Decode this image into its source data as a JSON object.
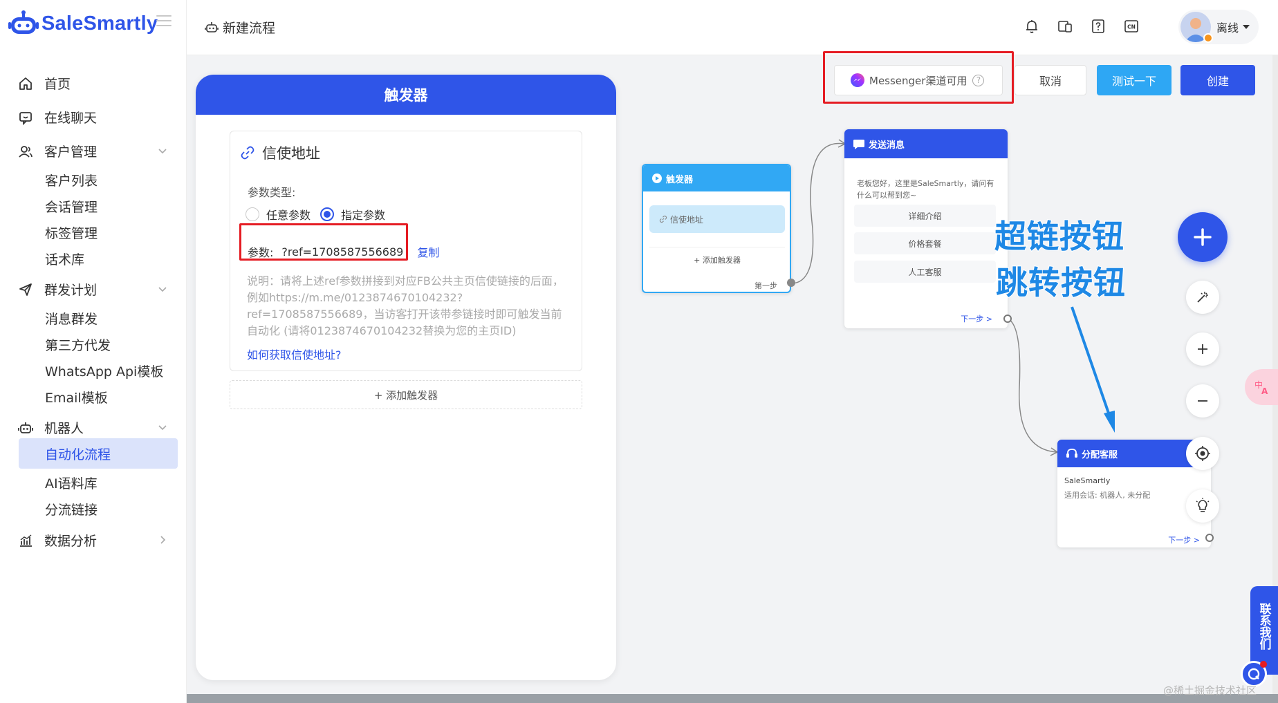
{
  "app": {
    "brand": "SaleSmartly"
  },
  "header": {
    "page_title": "新建流程",
    "user_status": "离线"
  },
  "sidebar": {
    "items": [
      {
        "label": "首页"
      },
      {
        "label": "在线聊天"
      },
      {
        "label": "客户管理"
      },
      {
        "label": "客户列表"
      },
      {
        "label": "会话管理"
      },
      {
        "label": "标签管理"
      },
      {
        "label": "话术库"
      },
      {
        "label": "群发计划"
      },
      {
        "label": "消息群发"
      },
      {
        "label": "第三方代发"
      },
      {
        "label": "WhatsApp Api模板"
      },
      {
        "label": "Email模板"
      },
      {
        "label": "机器人"
      },
      {
        "label": "自动化流程"
      },
      {
        "label": "AI语料库"
      },
      {
        "label": "分流链接"
      },
      {
        "label": "数据分析"
      }
    ],
    "active_item": "自动化流程"
  },
  "toolbar": {
    "channel_label": "Messenger渠道可用",
    "cancel_label": "取消",
    "test_label": "测试一下",
    "create_label": "创建"
  },
  "trigger_panel": {
    "title": "触发器",
    "card_title": "信使地址",
    "param_type_label": "参数类型:",
    "options": [
      "任意参数",
      "指定参数"
    ],
    "selected_option": "指定参数",
    "param_label": "参数:",
    "param_value": "?ref=1708587556689",
    "copy_label": "复制",
    "description": "说明：请将上述ref参数拼接到对应FB公共主页信使链接的后面，例如https://m.me/0123874670104232?ref=1708587556689，当访客打开该带参链接时即可触发当前自动化 (请将0123874670104232替换为您的主页ID)",
    "help_link": "如何获取信使地址?",
    "add_trigger": "+ 添加触发器"
  },
  "flow": {
    "trigger_node": {
      "title": "触发器",
      "item": "信使地址",
      "add": "+ 添加触发器",
      "next": "第一步"
    },
    "send_node": {
      "title": "发送消息",
      "message": "老板您好，这里是SaleSmartly，请问有什么可以帮到您~",
      "buttons": [
        "详细介绍",
        "价格套餐",
        "人工客服"
      ],
      "next": "下一步 >"
    },
    "assign_node": {
      "title": "分配客服",
      "line1": "SaleSmartly",
      "line2": "适用会话: 机器人, 未分配",
      "next": "下一步 >"
    }
  },
  "annotations": {
    "hyperlink_buttons": "超链按钮",
    "jump_button": "跳转按钮"
  },
  "floating": {
    "contact_us": "联系我们",
    "watermark": "@稀土掘金技术社区"
  },
  "colors": {
    "primary": "#2f55e8",
    "trigger_node": "#31a8f4",
    "test_button": "#2ea7f4",
    "highlight_box": "#e51c23",
    "annotation": "#1e88e5"
  }
}
